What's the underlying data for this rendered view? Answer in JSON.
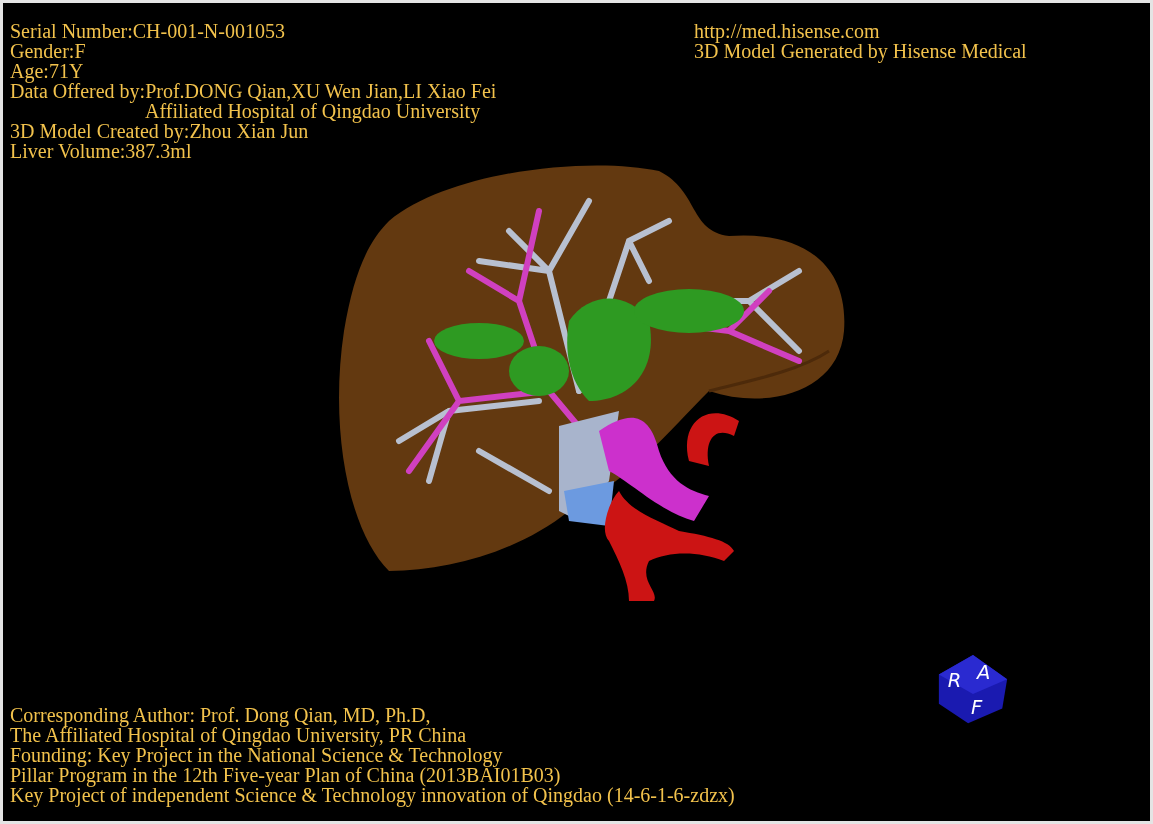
{
  "info_top_left": [
    {
      "text": "Serial Number:CH-001-N-001053"
    },
    {
      "text": "Gender:F"
    },
    {
      "text": "Age:71Y"
    },
    {
      "text": "Data Offered by:Prof.DONG Qian,XU Wen Jian,LI Xiao Fei",
      "continuation": "Affiliated Hospital of Qingdao University"
    },
    {
      "text": "3D Model Created by:Zhou Xian Jun"
    },
    {
      "text": "Liver Volume:387.3ml"
    }
  ],
  "info_top_right": [
    "http://med.hisense.com",
    "3D Model Generated by Hisense Medical"
  ],
  "credits_bottom": [
    "Corresponding Author: Prof. Dong Qian, MD, Ph.D,",
    "The Affiliated Hospital of Qingdao University, PR China",
    "Founding: Key Project in the National Science & Technology",
    "Pillar Program in the 12th Five-year Plan of China (2013BAI01B03)",
    "Key Project of independent Science & Technology innovation of Qingdao (14-6-1-6-zdzx)"
  ],
  "orientation_cube": {
    "labels": [
      "R",
      "A",
      "F"
    ]
  }
}
